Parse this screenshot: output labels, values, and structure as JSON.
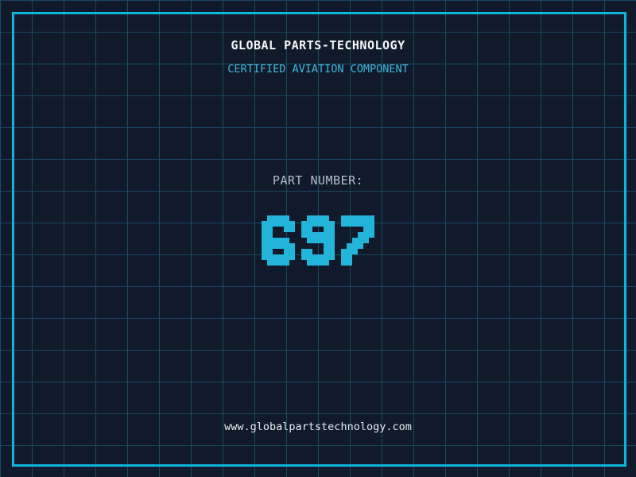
{
  "page": {
    "background_color": "#101a2a",
    "grid_color": "#1a4a62",
    "frame_color": "#0fb4dc"
  },
  "header": {
    "title": "GLOBAL PARTS-TECHNOLOGY",
    "title_color": "#f4f6f8",
    "subtitle": "CERTIFIED AVIATION COMPONENT",
    "subtitle_color": "#41b7da"
  },
  "part": {
    "label": "PART NUMBER:",
    "label_color": "#b2bfc8",
    "value": "697",
    "value_color": "#22b5d9"
  },
  "footer": {
    "url": "www.globalpartstechnology.com",
    "url_color": "#e6ecef"
  }
}
